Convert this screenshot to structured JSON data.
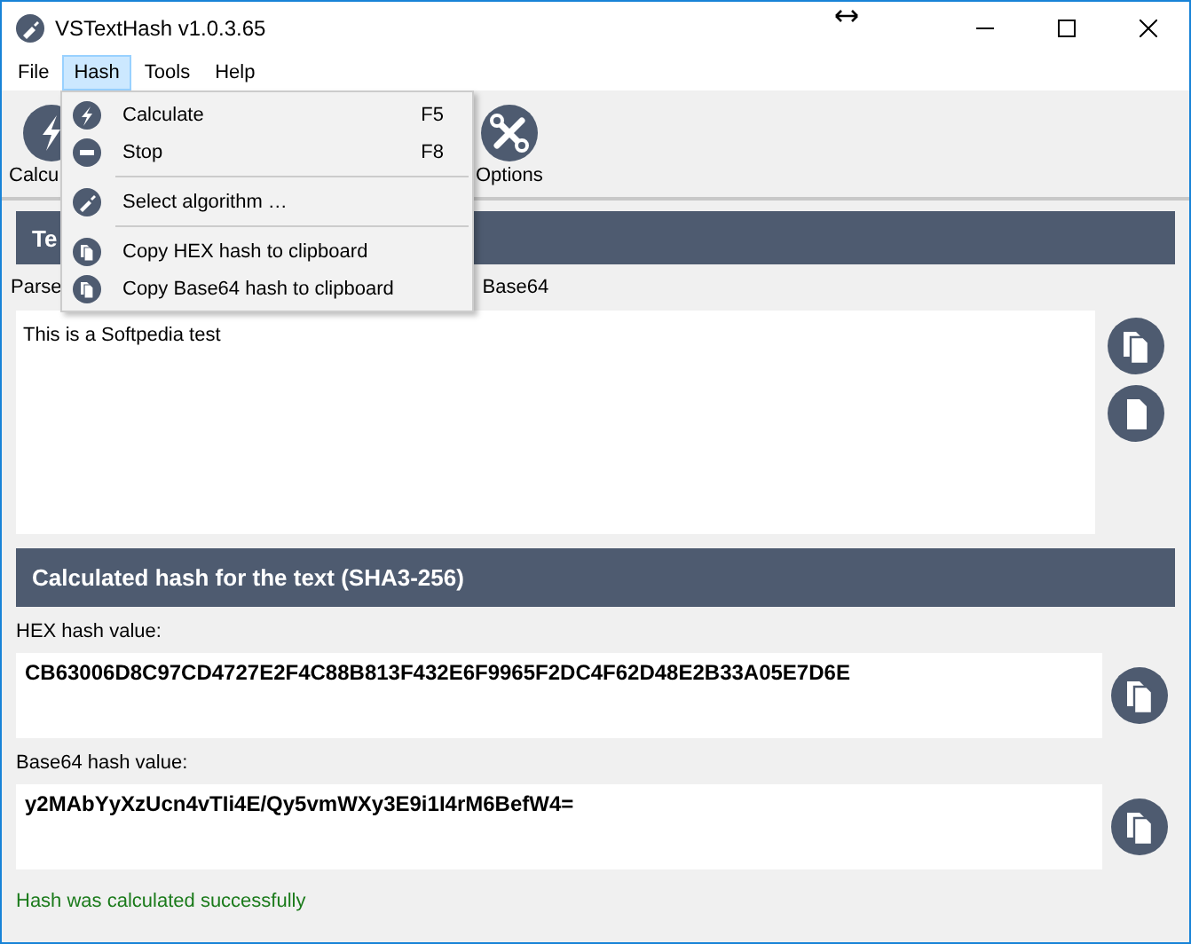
{
  "window": {
    "title": "VSTextHash v1.0.3.65"
  },
  "menu_bar": [
    {
      "label": "File",
      "selected": false
    },
    {
      "label": "Hash",
      "selected": true
    },
    {
      "label": "Tools",
      "selected": false
    },
    {
      "label": "Help",
      "selected": false
    }
  ],
  "toolbar": {
    "left_label": "Calcu",
    "right_label": "Options"
  },
  "text_section": {
    "header": "Te",
    "option_left": "Parse",
    "option_right": "Base64",
    "text": "This is a Softpedia test"
  },
  "hash_section": {
    "header": "Calculated hash for the text (SHA3-256)",
    "hex_label": "HEX hash value:",
    "hex_value": "CB63006D8C97CD4727E2F4C88B813F432E6F9965F2DC4F62D48E2B33A05E7D6E",
    "base64_label": "Base64 hash value:",
    "base64_value": "y2MAbYyXzUcn4vTIi4E/Qy5vmWXy3E9i1I4rM6BefW4="
  },
  "status_bar": {
    "message": "Hash was calculated successfully"
  },
  "hash_menu": [
    {
      "kind": "item",
      "label": "Calculate",
      "shortcut": "F5"
    },
    {
      "kind": "item",
      "label": "Stop",
      "shortcut": "F8"
    },
    {
      "kind": "separator"
    },
    {
      "kind": "item",
      "label": "Select algorithm …"
    },
    {
      "kind": "separator"
    },
    {
      "kind": "item",
      "label": "Copy HEX hash to clipboard"
    },
    {
      "kind": "item",
      "label": "Copy Base64 hash to clipboard"
    }
  ]
}
